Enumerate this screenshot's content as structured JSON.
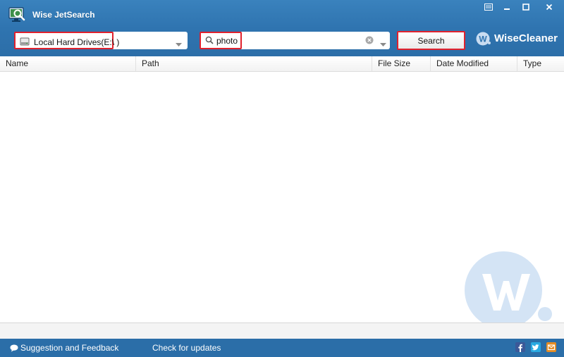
{
  "app": {
    "title": "Wise JetSearch",
    "icon": "magnifier-monitor-icon"
  },
  "window_controls": [
    "menu-icon",
    "minimize-icon",
    "maximize-icon",
    "close-icon"
  ],
  "toolbar": {
    "drive_select": {
      "value": "Local Hard Drives(E:\\ )",
      "icon": "hard-drive-icon"
    },
    "search": {
      "value": "photo",
      "placeholder": "",
      "icon": "search-icon"
    },
    "search_button_label": "Search",
    "brand": "WiseCleaner"
  },
  "table": {
    "columns": [
      "Name",
      "Path",
      "File Size",
      "Date Modified",
      "Type"
    ],
    "rows": []
  },
  "footer": {
    "feedback_label": "Suggestion and Feedback",
    "updates_label": "Check for updates",
    "social_icons": [
      "facebook-icon",
      "twitter-icon",
      "mail-icon"
    ]
  },
  "colors": {
    "accent_blue": "#2f74b0",
    "highlight_red": "#e0212d",
    "brand_watermark": "#d4e4f5"
  }
}
